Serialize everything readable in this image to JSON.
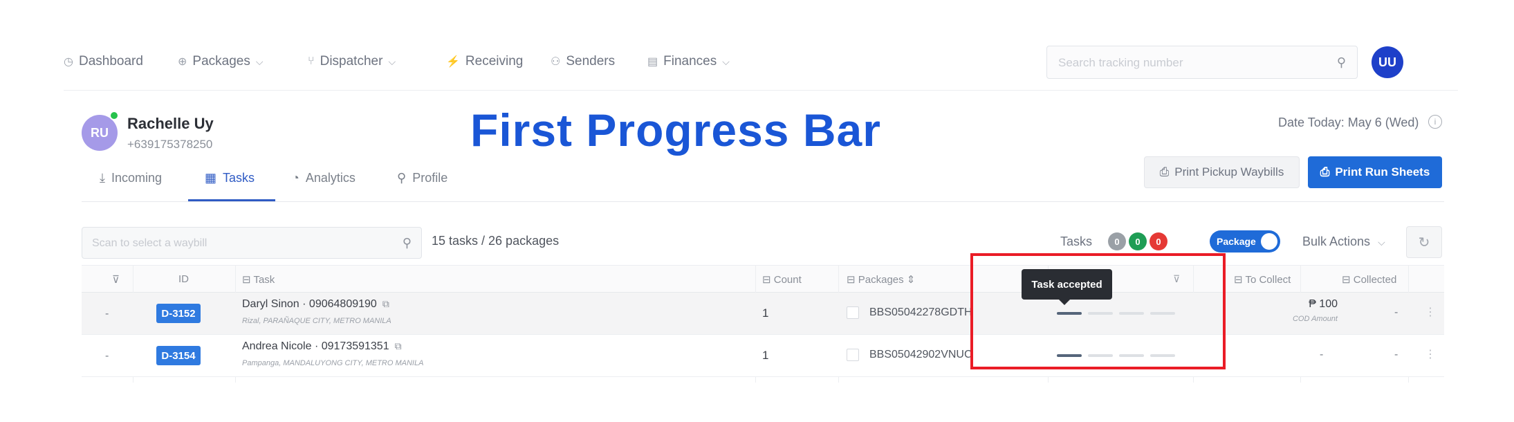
{
  "nav": {
    "items": [
      {
        "icon": "dashboard-icon",
        "label": "Dashboard",
        "dropdown": false
      },
      {
        "icon": "packages-icon",
        "label": "Packages",
        "dropdown": true
      },
      {
        "icon": "dispatcher-icon",
        "label": "Dispatcher",
        "dropdown": true
      },
      {
        "icon": "receiving-icon",
        "label": "Receiving",
        "dropdown": false
      },
      {
        "icon": "senders-icon",
        "label": "Senders",
        "dropdown": false
      },
      {
        "icon": "finances-icon",
        "label": "Finances",
        "dropdown": true
      }
    ],
    "search_placeholder": "Search tracking number",
    "user_initials": "UU"
  },
  "profile": {
    "initials": "RU",
    "name": "Rachelle Uy",
    "phone": "+639175378250"
  },
  "overlay_title": "First Progress Bar",
  "date_today": "Date Today: May 6 (Wed)",
  "tabs": [
    {
      "icon": "download-icon",
      "label": "Incoming",
      "active": false
    },
    {
      "icon": "tasks-icon",
      "label": "Tasks",
      "active": true
    },
    {
      "icon": "analytics-icon",
      "label": "Analytics",
      "active": false
    },
    {
      "icon": "profile-icon",
      "label": "Profile",
      "active": false
    }
  ],
  "buttons": {
    "print_pickup": "Print Pickup Waybills",
    "print_run": "Print Run Sheets"
  },
  "toolbar": {
    "scan_placeholder": "Scan to select a waybill",
    "count_text": "15 tasks / 26 packages",
    "tasks_label": "Tasks",
    "badges": [
      {
        "value": "0",
        "color": "#9aa0a6"
      },
      {
        "value": "0",
        "color": "#1f9d55"
      },
      {
        "value": "0",
        "color": "#e53935"
      }
    ],
    "toggle_label": "Package",
    "bulk_actions": "Bulk Actions"
  },
  "table": {
    "headers": {
      "id": "ID",
      "task": "Task",
      "count": "Count",
      "packages": "Packages",
      "to_collect": "To Collect",
      "collected": "Collected"
    },
    "rows": [
      {
        "dash": "-",
        "id": "D-3152",
        "task_name": "Daryl Sinon · 09064809190",
        "task_address": "Rizal, PARAÑAQUE CITY, METRO MANILA",
        "count": "1",
        "package": "BBS05042278GDTH",
        "progress_steps_done": 1,
        "progress_steps_total": 4,
        "to_collect": "₱ 100",
        "to_collect_label": "COD Amount",
        "collected": "-"
      },
      {
        "dash": "-",
        "id": "D-3154",
        "task_name": "Andrea Nicole · 09173591351",
        "task_address": "Pampanga, MANDALUYONG CITY, METRO MANILA",
        "count": "1",
        "package": "BBS05042902VNUC",
        "progress_steps_done": 1,
        "progress_steps_total": 4,
        "to_collect": "-",
        "to_collect_label": "",
        "collected": "-"
      }
    ]
  },
  "tooltip": "Task accepted",
  "colors": {
    "accent": "#1f6bd8",
    "annotation": "#ea1c26",
    "progress_done": "#55657a",
    "progress_todo": "#dde0e4"
  }
}
